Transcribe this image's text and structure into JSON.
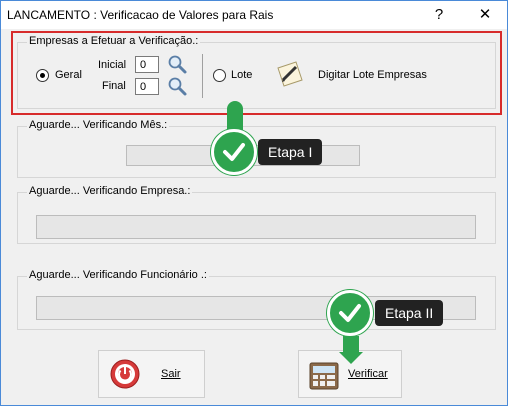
{
  "window": {
    "title": "LANCAMENTO : Verificacao de Valores para Rais",
    "help_label": "?",
    "close_label": "✕"
  },
  "empresas": {
    "legend": "Empresas a Efetuar a Verificação.:",
    "geral_label": "Geral",
    "inicial_label": "Inicial",
    "final_label": "Final",
    "inicial_value": "0",
    "final_value": "0",
    "lote_label": "Lote",
    "digitar_label": "Digitar Lote Empresas",
    "selected": "Geral"
  },
  "progress_groups": [
    {
      "label": "Aguarde... Verificando Mês.:"
    },
    {
      "label": "Aguarde... Verificando Empresa.:"
    },
    {
      "label": "Aguarde... Verificando Funcionário .:"
    }
  ],
  "buttons": {
    "sair_label": "Sair",
    "verificar_label": "Verificar"
  },
  "callouts": [
    {
      "label": "Etapa I"
    },
    {
      "label": "Etapa II"
    }
  ],
  "colors": {
    "highlight_red": "#d72b2b",
    "callout_green": "#2ea44f",
    "callout_dark": "#222222"
  },
  "icons": [
    "magnifier-icon",
    "pencil-notepad-icon",
    "power-icon",
    "calculator-icon",
    "checkmark-icon"
  ]
}
